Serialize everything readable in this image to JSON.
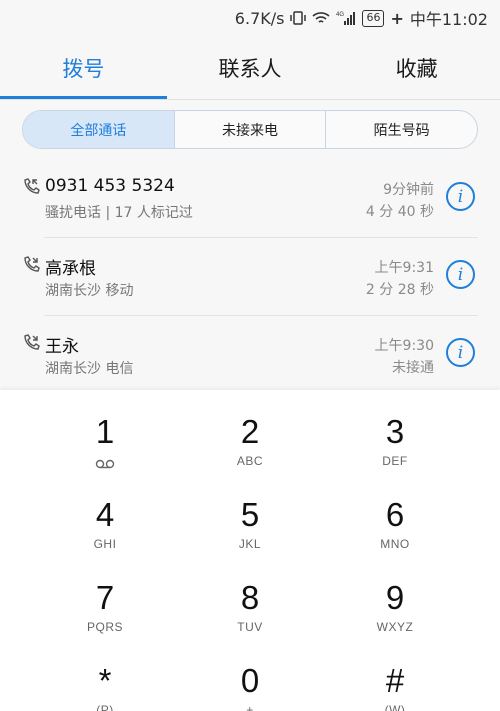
{
  "status_bar": {
    "speed": "6.7K/s",
    "battery": "66",
    "time": "中午11:02",
    "network": "4G"
  },
  "tabs": [
    {
      "label": "拨号",
      "active": true
    },
    {
      "label": "联系人",
      "active": false
    },
    {
      "label": "收藏",
      "active": false
    }
  ],
  "filters": [
    {
      "label": "全部通话",
      "active": true
    },
    {
      "label": "未接来电",
      "active": false
    },
    {
      "label": "陌生号码",
      "active": false
    }
  ],
  "calls": [
    {
      "name": "0931 453 5324",
      "sub": "骚扰电话 | 17 人标记过",
      "time": "9分钟前",
      "detail": "4 分 40 秒"
    },
    {
      "name": "高承根",
      "sub": "湖南长沙 移动",
      "time": "上午9:31",
      "detail": "2 分 28 秒"
    },
    {
      "name": "王永",
      "sub": "湖南长沙 电信",
      "time": "上午9:30",
      "detail": "未接通"
    }
  ],
  "keypad": [
    {
      "digit": "1",
      "letters": "voicemail-icon"
    },
    {
      "digit": "2",
      "letters": "ABC"
    },
    {
      "digit": "3",
      "letters": "DEF"
    },
    {
      "digit": "4",
      "letters": "GHI"
    },
    {
      "digit": "5",
      "letters": "JKL"
    },
    {
      "digit": "6",
      "letters": "MNO"
    },
    {
      "digit": "7",
      "letters": "PQRS"
    },
    {
      "digit": "8",
      "letters": "TUV"
    },
    {
      "digit": "9",
      "letters": "WXYZ"
    },
    {
      "digit": "*",
      "letters": "(P)"
    },
    {
      "digit": "0",
      "letters": "+"
    },
    {
      "digit": "#",
      "letters": "(W)"
    }
  ],
  "colors": {
    "accent": "#1f7fdb",
    "segment_active_bg": "#d8e7f7"
  }
}
